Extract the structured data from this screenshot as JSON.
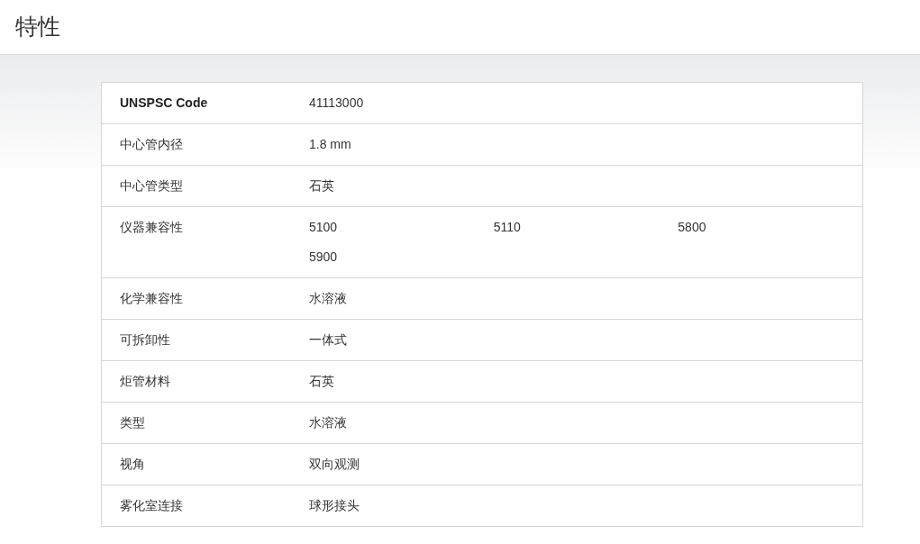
{
  "page": {
    "title": "特性"
  },
  "table": {
    "rows": [
      {
        "kind": "heading",
        "label": "UNSPSC Code",
        "values": [
          "41113000"
        ]
      },
      {
        "kind": "property",
        "label": "中心管内径",
        "values": [
          "1.8 mm"
        ]
      },
      {
        "kind": "property",
        "label": "中心管类型",
        "values": [
          "石英"
        ]
      },
      {
        "kind": "property",
        "label": "仪器兼容性",
        "values": [
          "5100",
          "5110",
          "5800",
          "5900"
        ]
      },
      {
        "kind": "property",
        "label": "化学兼容性",
        "values": [
          "水溶液"
        ]
      },
      {
        "kind": "property",
        "label": "可拆卸性",
        "values": [
          "一体式"
        ]
      },
      {
        "kind": "property",
        "label": "炬管材料",
        "values": [
          "石英"
        ]
      },
      {
        "kind": "property",
        "label": "类型",
        "values": [
          "水溶液"
        ]
      },
      {
        "kind": "property",
        "label": "视角",
        "values": [
          "双向观测"
        ]
      },
      {
        "kind": "property",
        "label": "雾化室连接",
        "values": [
          "球形接头"
        ]
      }
    ]
  }
}
